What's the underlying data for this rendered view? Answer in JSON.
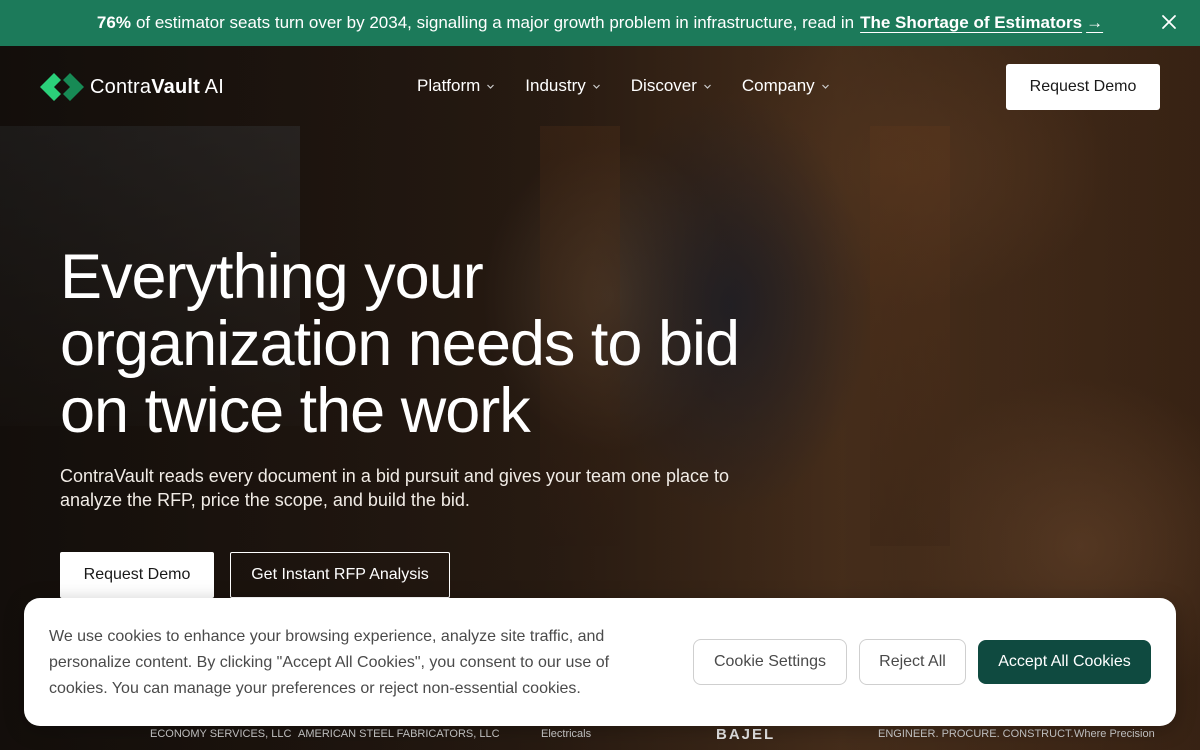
{
  "announcement": {
    "percent": "76%",
    "text": "of estimator seats turn over by 2034, signalling a major growth problem in infrastructure, read in",
    "link": "The Shortage of Estimators",
    "arrow": "→"
  },
  "nav": {
    "brand_light": "Contra",
    "brand_bold": "Vault",
    "brand_suffix": " AI",
    "menu": [
      {
        "label": "Platform"
      },
      {
        "label": "Industry"
      },
      {
        "label": "Discover"
      },
      {
        "label": "Company"
      }
    ],
    "cta": "Request Demo"
  },
  "hero": {
    "headline": "Everything your organization needs to bid on twice the work",
    "subhead": "ContraVault reads every document in a bid pursuit and gives your team one place to analyze the RFP, price the scope, and build the bid.",
    "cta_primary": "Request Demo",
    "cta_secondary": "Get Instant RFP Analysis"
  },
  "logos": [
    {
      "label": "ECONOMY SERVICES, LLC"
    },
    {
      "label": "AMERICAN STEEL FABRICATORS, LLC"
    },
    {
      "label": "Electricals"
    },
    {
      "label": "BAJEL"
    },
    {
      "label": "ENGINEER. PROCURE. CONSTRUCT."
    },
    {
      "label": "Where Precision"
    }
  ],
  "cookie": {
    "text": "We use cookies to enhance your browsing experience, analyze site traffic, and personalize content. By clicking \"Accept All Cookies\", you consent to our use of cookies. You can manage your preferences or reject non-essential cookies.",
    "settings": "Cookie Settings",
    "reject": "Reject All",
    "accept": "Accept All Cookies"
  },
  "colors": {
    "announce_bg": "#1c7a5a",
    "accept_bg": "#0f4a40",
    "logo_green": "#2bd07a"
  }
}
